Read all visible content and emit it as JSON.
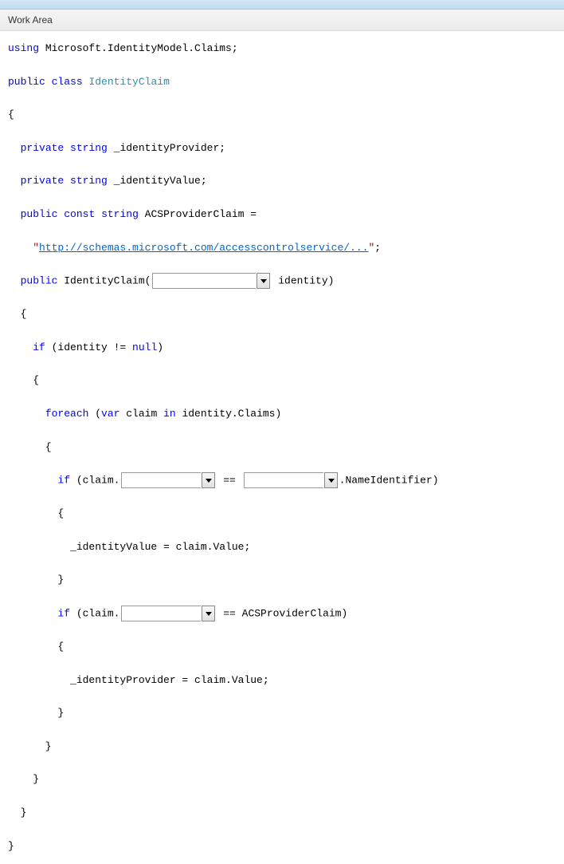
{
  "header": {
    "title": "Work Area"
  },
  "code": {
    "l1a": "using",
    "l1b": " Microsoft.IdentityModel.Claims;",
    "l2a": "public",
    "l2b": "class",
    "l2c": "IdentityClaim",
    "l3": "{",
    "l4a": "private",
    "l4b": "string",
    "l4c": " _identityProvider;",
    "l5a": "private",
    "l5b": "string",
    "l5c": " _identityValue;",
    "l6a": "public",
    "l6b": "const",
    "l6c": "string",
    "l6d": " ACSProviderClaim =",
    "l7a": "    \"",
    "l7b": "http://schemas.microsoft.com/accesscontrolservice/...",
    "l7c": "\"",
    "l7d": ";",
    "l8a": "public",
    "l8b": " IdentityClaim(",
    "l8c": " identity)",
    "l9": "  {",
    "l10a": "if",
    "l10b": " (identity != ",
    "null": "null",
    "l10c": ")",
    "l11": "    {",
    "l12a": "foreach",
    "l12b": " (",
    "var": "var",
    "l12c": " claim ",
    "in": "in",
    "l12d": " identity.Claims)",
    "l13": "      {",
    "l14a": "if",
    "l14b": " (claim.",
    "l14c": " == ",
    "l14d": ".NameIdentifier)",
    "l15": "        {",
    "l16": "          _identityValue = claim.Value;",
    "l17": "        }",
    "l18a": "if",
    "l18b": " (claim.",
    "l18c": " == ACSProviderClaim)",
    "l19": "        {",
    "l20": "          _identityProvider = claim.Value;",
    "l21": "        }",
    "l22": "      }",
    "l23": "    }",
    "l24": "  }",
    "l25": "}"
  }
}
